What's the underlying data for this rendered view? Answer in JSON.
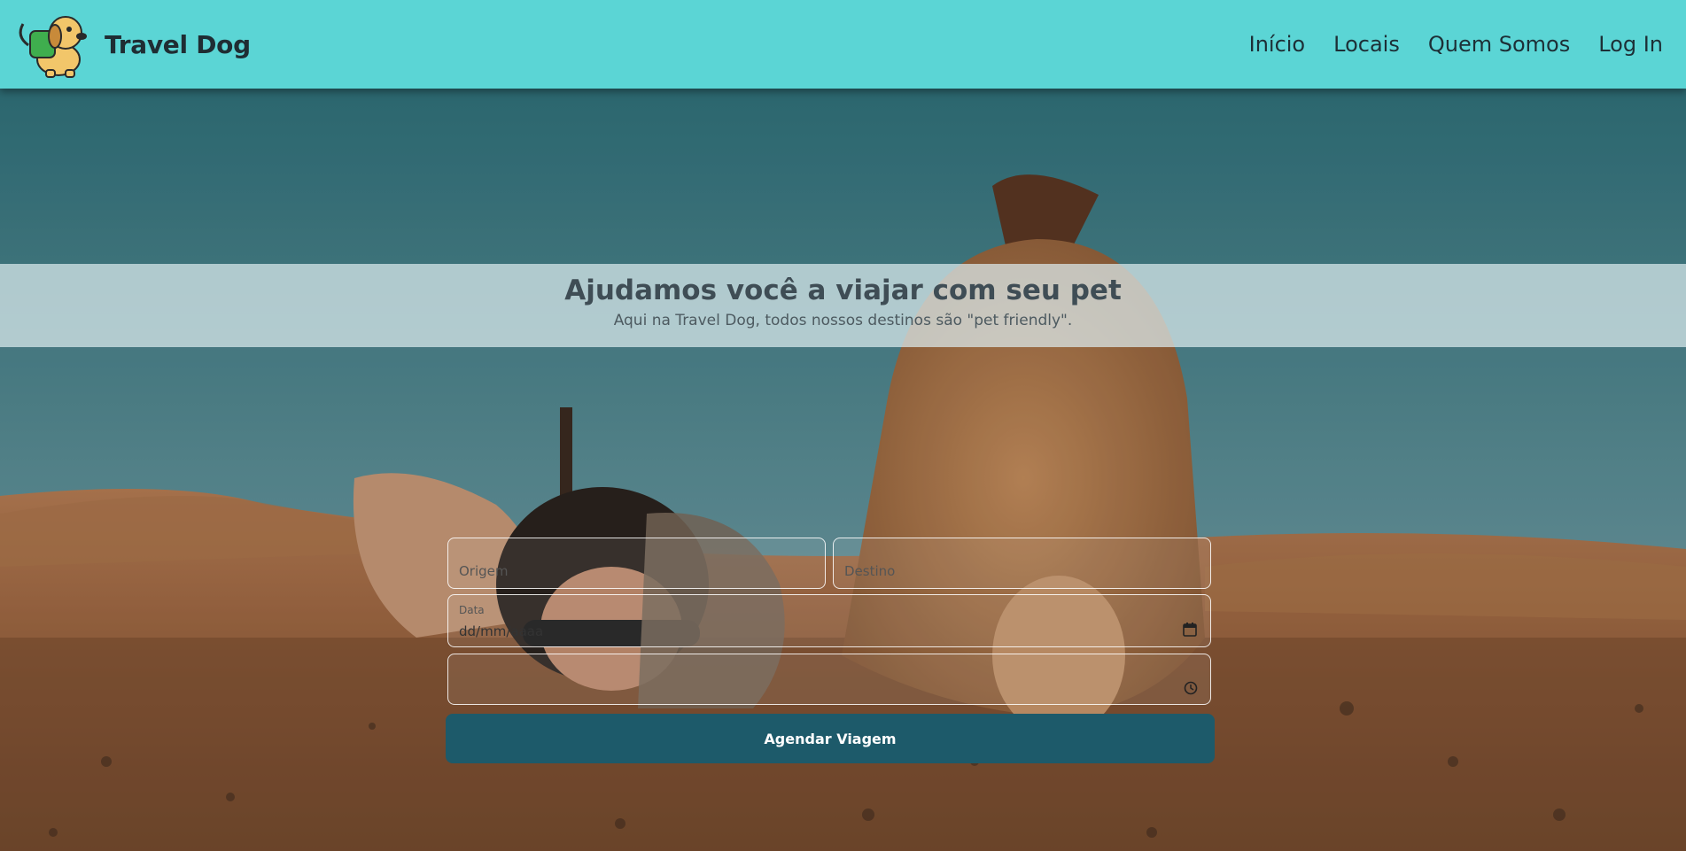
{
  "header": {
    "brand_name": "Travel Dog",
    "nav": [
      {
        "label": "Início"
      },
      {
        "label": "Locais"
      },
      {
        "label": "Quem Somos"
      },
      {
        "label": "Log In"
      }
    ]
  },
  "hero": {
    "title": "Ajudamos você a viajar com seu pet",
    "subtitle": "Aqui na Travel Dog, todos nossos destinos são \"pet friendly\"."
  },
  "form": {
    "origin_placeholder": "Origem",
    "destination_placeholder": "Destino",
    "date_label": "Data",
    "date_value": "dd/mm/aaaa",
    "time_value": "",
    "submit_label": "Agendar Viagem"
  },
  "colors": {
    "navbar": "#5bd5d5",
    "button": "#1d5a6a"
  },
  "icons": [
    "dog-logo-icon",
    "calendar-icon",
    "clock-icon"
  ]
}
